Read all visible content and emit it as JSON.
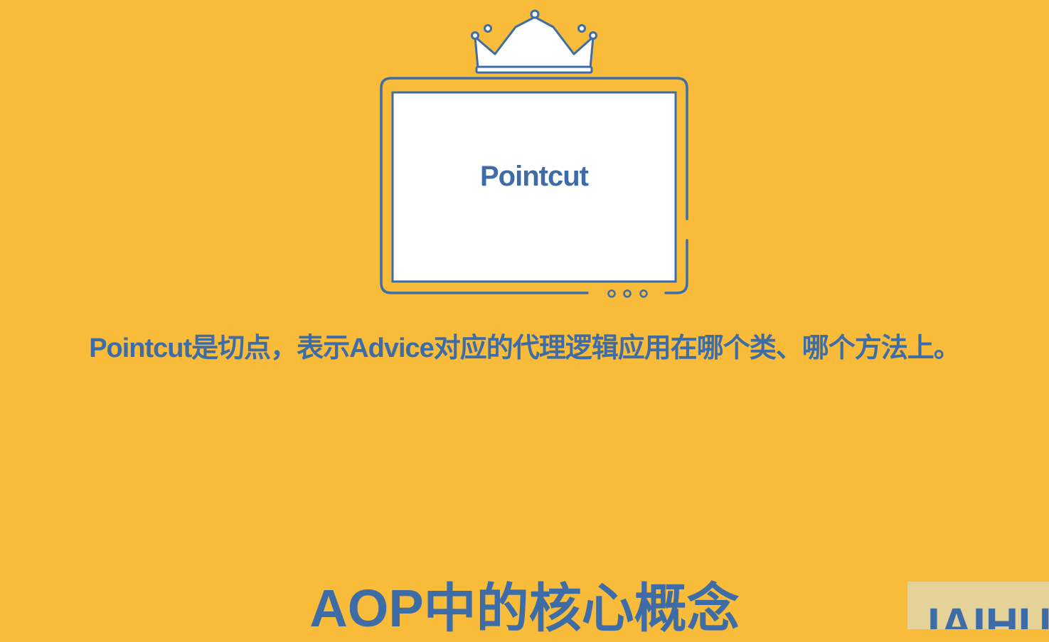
{
  "slide": {
    "screen_label": "Pointcut",
    "description": "Pointcut是切点，表示Advice对应的代理逻辑应用在哪个类、哪个方法上。",
    "title": "AOP中的核心概念",
    "watermark_text": "IAIHU"
  },
  "colors": {
    "background": "#F8BB3A",
    "accent": "#3E6CA7",
    "screen_fill": "#FFFFFF"
  },
  "icons": {
    "crown": "crown-icon",
    "monitor": "monitor-frame-icon"
  }
}
